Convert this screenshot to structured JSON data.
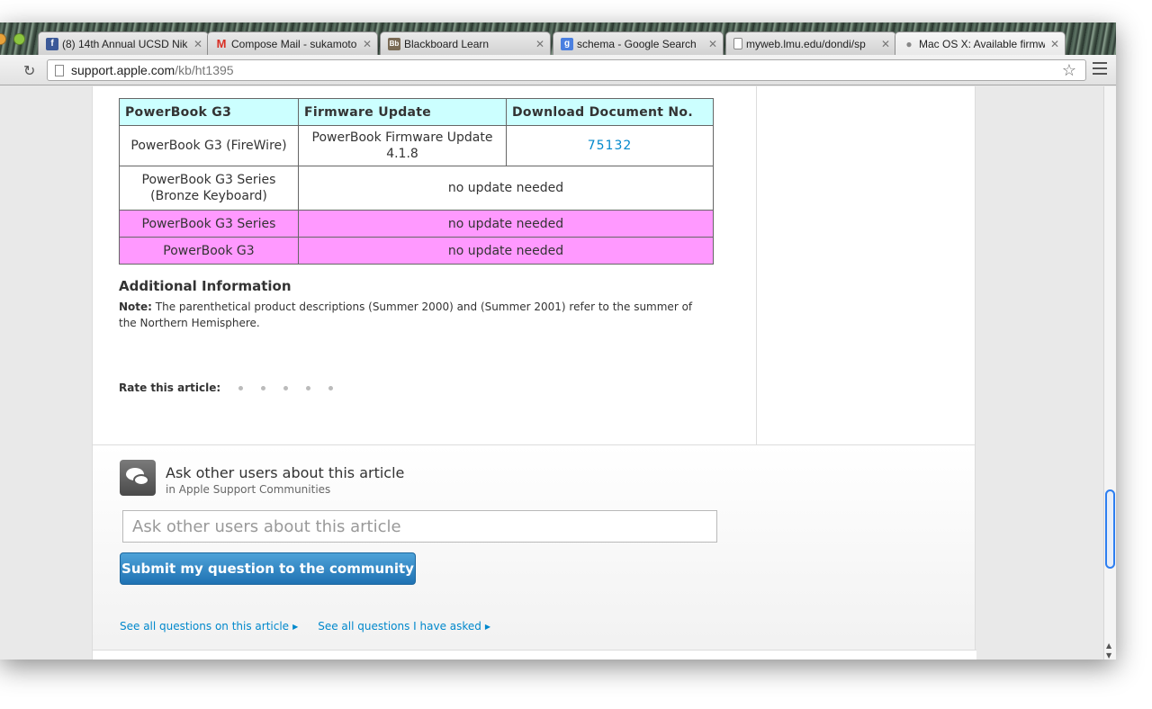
{
  "browser": {
    "tabs": [
      {
        "title": "(8) 14th Annual UCSD Nik",
        "favicon": "facebook-icon"
      },
      {
        "title": "Compose Mail - sukamoto",
        "favicon": "gmail-icon"
      },
      {
        "title": "Blackboard Learn",
        "favicon": "blackboard-icon"
      },
      {
        "title": "schema - Google Search",
        "favicon": "google-icon"
      },
      {
        "title": "myweb.lmu.edu/dondi/sp",
        "favicon": "page-icon"
      },
      {
        "title": "Mac OS X: Available firmw",
        "favicon": "apple-icon"
      }
    ],
    "url_host": "support.apple.com",
    "url_path": "/kb/ht1395"
  },
  "table": {
    "headers": [
      "PowerBook G3",
      "Firmware Update",
      "Download Document No."
    ],
    "rows": [
      {
        "model": "PowerBook G3 (FireWire)",
        "update": "PowerBook Firmware Update 4.1.8",
        "doc": "75132"
      },
      {
        "model": "PowerBook G3 Series (Bronze Keyboard)",
        "update": "no update needed"
      },
      {
        "model": "PowerBook G3 Series",
        "update": "no update needed"
      },
      {
        "model": "PowerBook G3",
        "update": "no update needed"
      }
    ]
  },
  "additional": {
    "heading": "Additional Information",
    "note_label": "Note:",
    "note_text": " The parenthetical product descriptions (Summer 2000) and (Summer 2001) refer to the summer of the Northern Hemisphere."
  },
  "rating": {
    "label": "Rate this article:"
  },
  "community": {
    "title": "Ask other users about this article",
    "subtitle": "in Apple Support Communities",
    "input_placeholder": "Ask other users about this article",
    "submit_label": "Submit my question to the community",
    "link_all": "See all questions on this article",
    "link_mine": "See all questions I have asked"
  },
  "colors": {
    "header_bg": "#ccffff",
    "pink_row_bg": "#ff99ff",
    "link": "#0088cc",
    "button": "#2a82c4"
  }
}
